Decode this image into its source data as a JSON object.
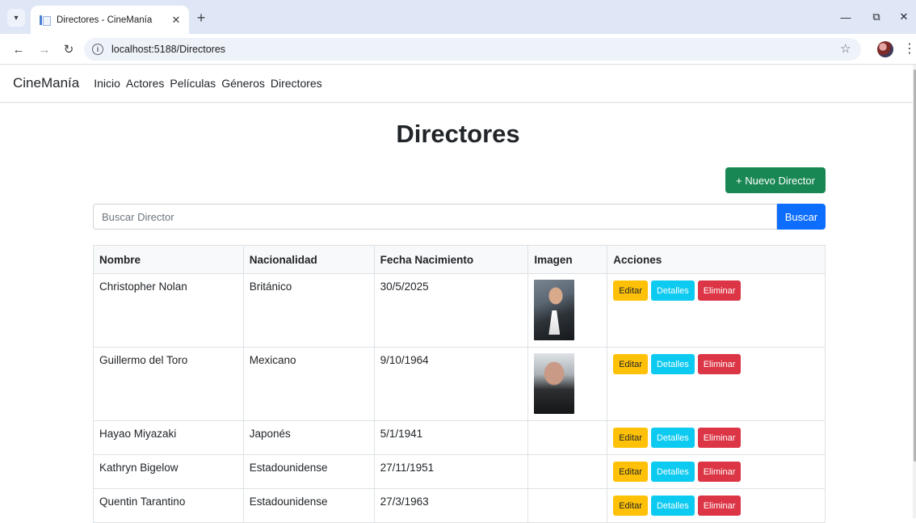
{
  "browser": {
    "tab_title": "Directores - CineManía",
    "url": "localhost:5188/Directores"
  },
  "site": {
    "brand": "CineManía",
    "nav": [
      "Inicio",
      "Actores",
      "Películas",
      "Géneros",
      "Directores"
    ]
  },
  "page": {
    "title": "Directores",
    "new_button": "+ Nuevo Director",
    "search_placeholder": "Buscar Director",
    "search_button": "Buscar"
  },
  "table": {
    "headers": [
      "Nombre",
      "Nacionalidad",
      "Fecha Nacimiento",
      "Imagen",
      "Acciones"
    ],
    "action_labels": {
      "edit": "Editar",
      "details": "Detalles",
      "delete": "Eliminar"
    },
    "rows": [
      {
        "name": "Christopher Nolan",
        "nationality": "Británico",
        "birth_date": "30/5/2025"
      },
      {
        "name": "Guillermo del Toro",
        "nationality": "Mexicano",
        "birth_date": "9/10/1964"
      },
      {
        "name": "Hayao Miyazaki",
        "nationality": "Japonés",
        "birth_date": "5/1/1941"
      },
      {
        "name": "Kathryn Bigelow",
        "nationality": "Estadounidense",
        "birth_date": "27/11/1951"
      },
      {
        "name": "Quentin Tarantino",
        "nationality": "Estadounidense",
        "birth_date": "27/3/1963"
      }
    ]
  },
  "colors": {
    "success": "#198754",
    "primary": "#0d6efd",
    "warning": "#ffc107",
    "info": "#0dcaf0",
    "danger": "#dc3545"
  }
}
